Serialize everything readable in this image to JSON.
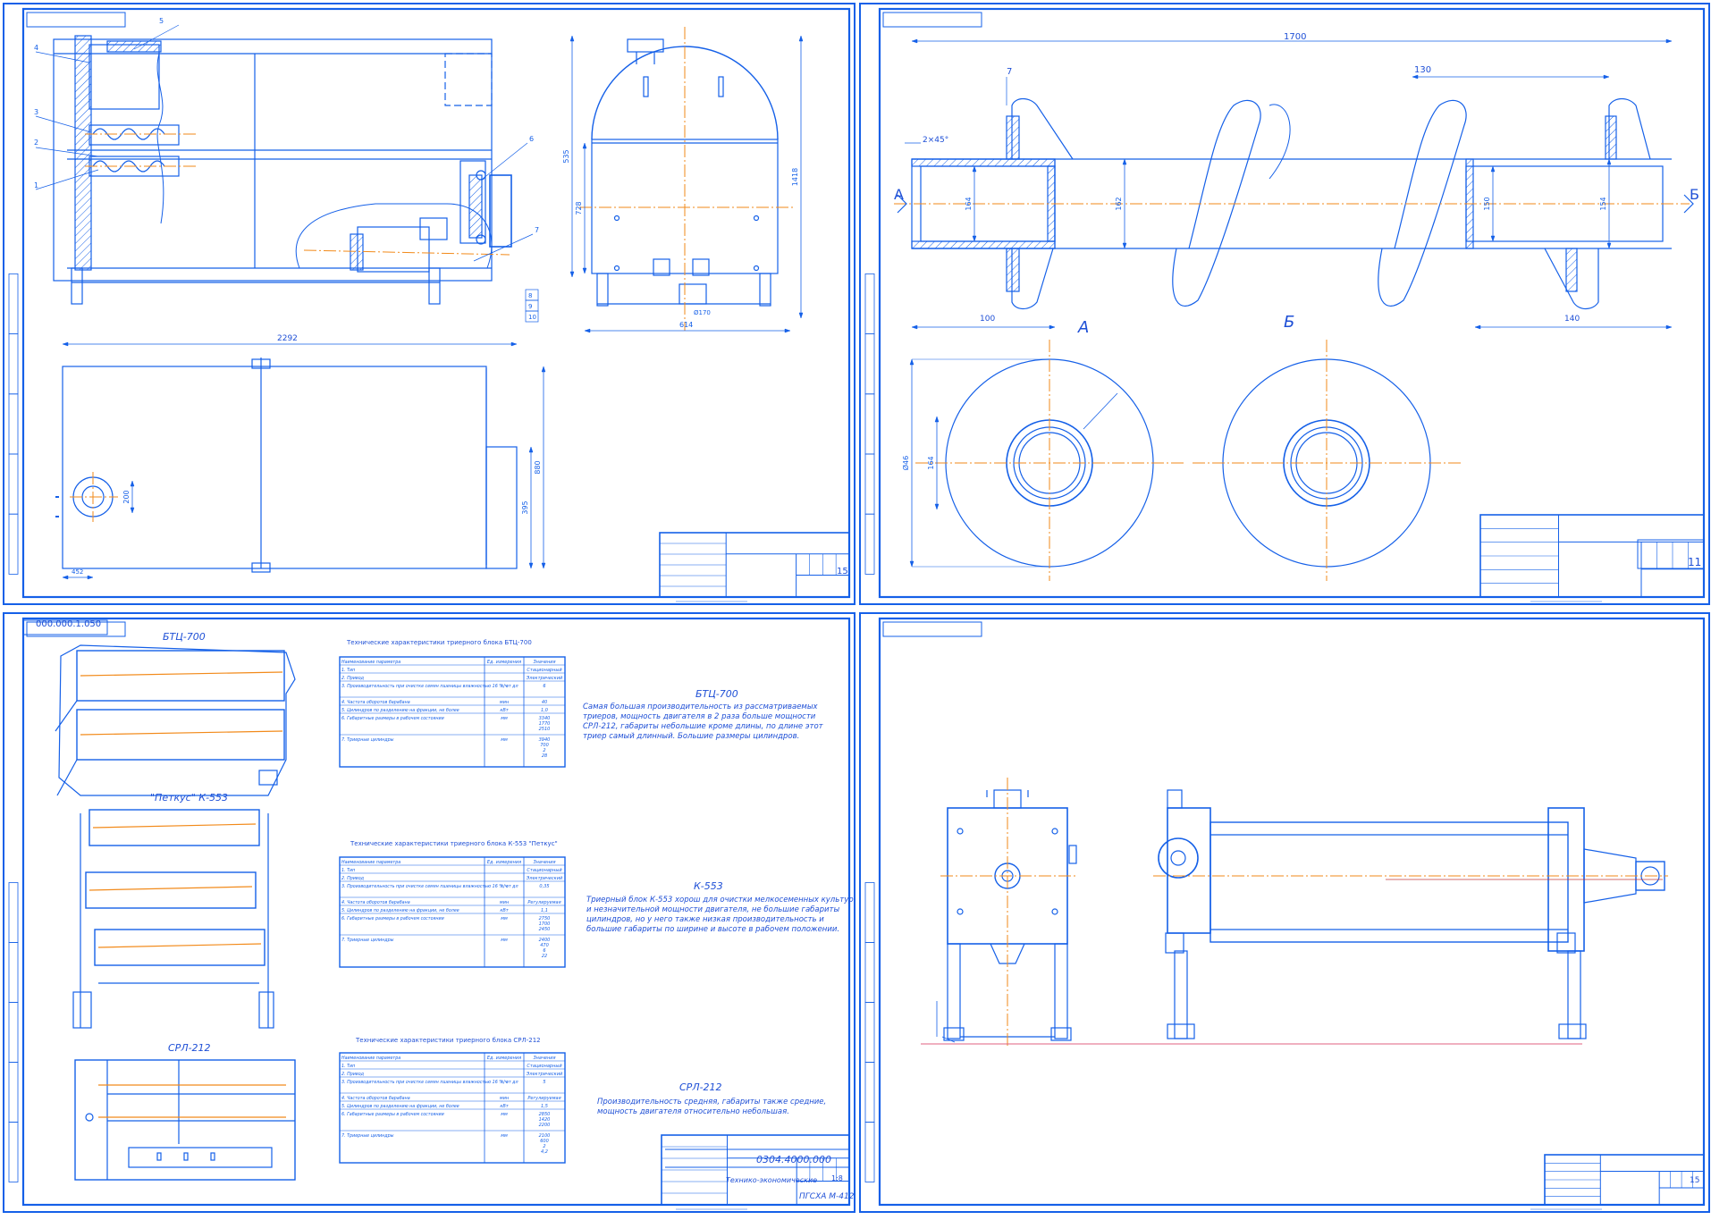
{
  "colors": {
    "line": "#1560e8",
    "axis": "#f28a1a",
    "hatch": "#1560e8",
    "redline": "#e06080",
    "frame": "#1560e8"
  },
  "sheet_top_right": {
    "dims": {
      "total": "1700",
      "pitch": "130",
      "flange": "7",
      "chamfer": "2×45°",
      "left_len": "100",
      "right_len": "140",
      "d_inner_left": "164",
      "d_pipe": "162",
      "d_inner_right": "150",
      "d_outer_right": "154",
      "d_disc": "Ø46",
      "d_hub": "164"
    },
    "section_marks": {
      "left": "A",
      "right": "Б",
      "view_a": "А",
      "view_b": "Б"
    },
    "stamp_sheet": "11"
  },
  "sheet_top_left": {
    "callouts": [
      "1",
      "2",
      "3",
      "4",
      "5",
      "6",
      "7",
      "8",
      "9",
      "10"
    ],
    "dims": {
      "width": "2292",
      "side_h": "535",
      "side_h2": "728",
      "total_h": "1418",
      "bottom": "614",
      "hole": "Ø170",
      "plan_h": "880",
      "plan_h2": "395",
      "offset": "452",
      "d_port": "200"
    },
    "stamp_sheet": "15"
  },
  "sheet_bottom_left": {
    "corner_code": "000.000.1.050",
    "machines": [
      {
        "name": "БТЦ-700"
      },
      {
        "name": "\"Петкус\" К-553"
      },
      {
        "name": "СРЛ-212"
      }
    ],
    "tables": [
      {
        "caption": "Технические характеристики триерного блока БТЦ-700",
        "headers": [
          "Наименование параметра",
          "Ед. измерения",
          "Значения"
        ],
        "rows": [
          [
            "1. Тип",
            "",
            "Стационарный"
          ],
          [
            "2. Привод",
            "",
            "Электрический"
          ],
          [
            "3. Производительность при очистке семян пшеницы влажностью 16 %, от длинных и коротких примесей",
            "т/ч",
            "6"
          ],
          [
            "4. Частота оборотов барабана",
            "мин",
            "40"
          ],
          [
            "5. Цилиндров по разделению на фракции, не более",
            "кВт",
            "1,0"
          ],
          [
            "6. Габаритные размеры в рабочем состоянии",
            "мм",
            "3340 / 1770 / 2510"
          ],
          [
            "7. Триерные цилиндры",
            "мм",
            "3940 / 700 / 2 / 28"
          ]
        ],
        "desc_title": "БТЦ-700",
        "desc": "Самая большая производительность из рассматриваемых триеров, мощность двигателя в 2 раза больше мощности СРЛ-212, габариты небольшие кроме длины, по длине этот триер самый длинный. Большие размеры цилиндров."
      },
      {
        "caption": "Технические характеристики триерного блока К-553 \"Петкус\"",
        "headers": [
          "Наименование параметра",
          "Ед. измерения",
          "Значения"
        ],
        "rows": [
          [
            "1. Тип",
            "",
            "Стационарный"
          ],
          [
            "2. Привод",
            "",
            "Электрический"
          ],
          [
            "3. Производительность при очистке семян пшеницы влажностью 16 %, от длинных и коротких примесей",
            "т/ч",
            "0,35"
          ],
          [
            "4. Частота оборотов барабана",
            "мин",
            "Регулируемая"
          ],
          [
            "5. Цилиндров по разделению на фракции, не более",
            "кВт",
            "1,1"
          ],
          [
            "6. Габаритные размеры в рабочем состоянии",
            "мм",
            "2750 / 1700 / 2450"
          ],
          [
            "7. Триерные цилиндры",
            "мм",
            "2400 / 470 / 6 / 22"
          ]
        ],
        "desc_title": "К-553",
        "desc": "Триерный блок К-553 хорош для очистки мелкосеменных культур и незначительной мощности двигателя, не большие габариты цилиндров, но у него также низкая производительность и большие габариты по ширине и высоте в рабочем положении."
      },
      {
        "caption": "Технические характеристики триерного блока СРЛ-212",
        "headers": [
          "Наименование параметра",
          "Ед. измерения",
          "Значения"
        ],
        "rows": [
          [
            "1. Тип",
            "",
            "Стационарный"
          ],
          [
            "2. Привод",
            "",
            "Электрический"
          ],
          [
            "3. Производительность при очистке семян пшеницы влажностью 16 %, от длинных и коротких примесей",
            "т/ч",
            "5"
          ],
          [
            "4. Частота оборотов барабана",
            "мин",
            "Регулируемая"
          ],
          [
            "5. Цилиндров по разделению на фракции, не более",
            "кВт",
            "1,5"
          ],
          [
            "6. Габаритные размеры в рабочем состоянии",
            "мм",
            "2850 / 1420 / 2200"
          ],
          [
            "7. Триерные цилиндры",
            "мм",
            "2100 / 600 / 2 / 4,2"
          ]
        ],
        "desc_title": "СРЛ-212",
        "desc": "Производительность средняя, габариты также средние, мощность двигателя относительно небольшая."
      }
    ],
    "stamp": {
      "code": "0304.4000.000",
      "title": "Технико-экономические",
      "group": "ПГСХА М-412",
      "sheet": "1:8"
    }
  },
  "sheet_bottom_right": {
    "stamp_sheet": "15"
  }
}
